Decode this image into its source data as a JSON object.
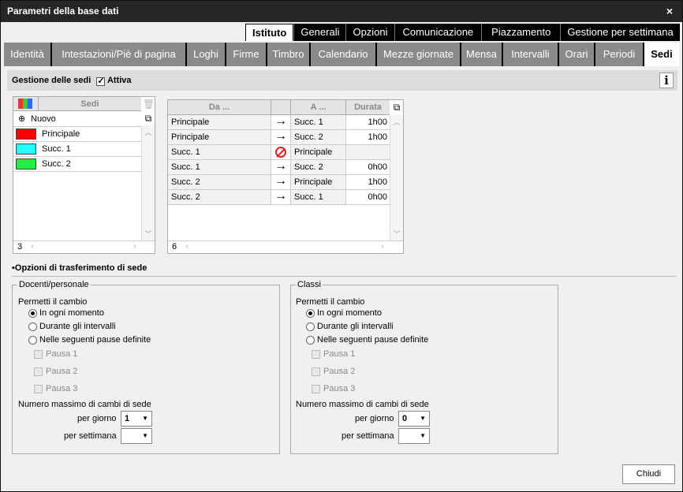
{
  "window": {
    "title": "Parametri della base dati",
    "close_glyph": "×"
  },
  "top_tabs": [
    "Istituto",
    "Generali",
    "Opzioni",
    "Comunicazione",
    "Piazzamento",
    "Gestione per settimana"
  ],
  "sub_tabs": [
    "Identità",
    "Intestazioni/Piè di pagina",
    "Loghi",
    "Firme",
    "Timbro",
    "Calendario",
    "Mezze giornate",
    "Mensa",
    "Intervalli",
    "Orari",
    "Periodi",
    "Sedi"
  ],
  "section": {
    "title": "Gestione delle sedi",
    "active_label": "Attiva",
    "active_checked": true,
    "info": "i"
  },
  "sedi_list": {
    "header": "Sedi",
    "new_label": "Nuovo",
    "items": [
      {
        "label": "Principale",
        "color": "#ff0000"
      },
      {
        "label": "Succ. 1",
        "color": "#22ffff"
      },
      {
        "label": "Succ. 2",
        "color": "#22ee44"
      }
    ],
    "count": "3"
  },
  "transfers": {
    "headers": {
      "from": "Da ...",
      "to": "A ...",
      "duration": "Durata"
    },
    "rows": [
      {
        "from": "Principale",
        "to": "Succ. 1",
        "duration": "1h00",
        "allowed": true
      },
      {
        "from": "Principale",
        "to": "Succ. 2",
        "duration": "1h00",
        "allowed": true
      },
      {
        "from": "Succ. 1",
        "to": "Principale",
        "duration": "",
        "allowed": false
      },
      {
        "from": "Succ. 1",
        "to": "Succ. 2",
        "duration": "0h00",
        "allowed": true
      },
      {
        "from": "Succ. 2",
        "to": "Principale",
        "duration": "1h00",
        "allowed": true
      },
      {
        "from": "Succ. 2",
        "to": "Succ. 1",
        "duration": "0h00",
        "allowed": true
      }
    ],
    "count": "6"
  },
  "options_title": "Opzioni di trasferimento di sede",
  "groups": [
    {
      "legend": "Docenti/personale",
      "permit_label": "Permetti il cambio",
      "radios": [
        "In ogni momento",
        "Durante gli intervalli",
        "Nelle seguenti pause definite"
      ],
      "selected": 0,
      "pauses": [
        "Pausa 1",
        "Pausa 2",
        "Pausa 3"
      ],
      "max_label": "Numero massimo di cambi di sede",
      "per_day_label": "per giorno",
      "per_day_value": "1",
      "per_week_label": "per settimana",
      "per_week_value": ""
    },
    {
      "legend": "Classi",
      "permit_label": "Permetti il cambio",
      "radios": [
        "In ogni momento",
        "Durante gli intervalli",
        "Nelle seguenti pause definite"
      ],
      "selected": 0,
      "pauses": [
        "Pausa 1",
        "Pausa 2",
        "Pausa 3"
      ],
      "max_label": "Numero massimo di cambi di sede",
      "per_day_label": "per giorno",
      "per_day_value": "0",
      "per_week_label": "per settimana",
      "per_week_value": ""
    }
  ],
  "close_button": "Chiudi"
}
